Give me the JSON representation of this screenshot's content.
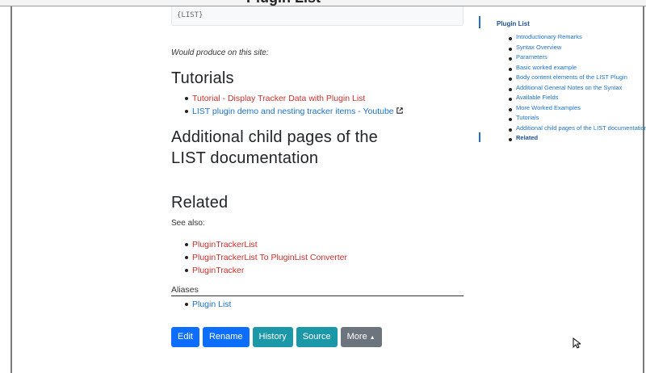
{
  "page": {
    "top_title": "Plugin List",
    "code_snippet": "{LIST}",
    "produce_note": "Would produce on this site:"
  },
  "sections": {
    "tutorials": {
      "heading": "Tutorials",
      "items": [
        {
          "label": "Tutorial - Display Tracker Data with Plugin List",
          "color": "#c9302c"
        },
        {
          "label": "LIST plugin demo and nesting tracker items - Youtube",
          "color": "#1d72c8",
          "external": true
        }
      ]
    },
    "child_pages": {
      "heading": "Additional child pages of the LIST documentation"
    },
    "related": {
      "heading": "Related",
      "see_also": "See also:",
      "items": [
        "PluginTrackerList",
        "PluginTrackerList To PluginList Converter",
        "PluginTracker"
      ],
      "aliases_label": "Aliases",
      "aliases": [
        "Plugin List"
      ]
    }
  },
  "actions": {
    "edit": "Edit",
    "rename": "Rename",
    "history": "History",
    "source": "Source",
    "more": "More"
  },
  "toc": {
    "title": "Plugin List",
    "items": [
      "Introductionary Remarks",
      "Syntax Overview",
      "Parameters",
      "Basic worked example",
      "Body content elements of the LIST Plugin",
      "Additional General Notes on the Syntax",
      "Available Fields",
      "More Worked Examples",
      "Tutorials",
      "Additional child pages of the LIST documentation",
      "Related"
    ],
    "active": "Related"
  },
  "colors": {
    "link_red": "#c9302c",
    "link_blue": "#1d72c8",
    "btn_blue": "#0d6efd",
    "btn_teal": "#1b98a8",
    "btn_gray": "#6c757d"
  },
  "icons": {
    "external_link": "external-link-icon",
    "caret_up": "caret-up-icon",
    "cursor": "mouse-cursor-icon"
  }
}
